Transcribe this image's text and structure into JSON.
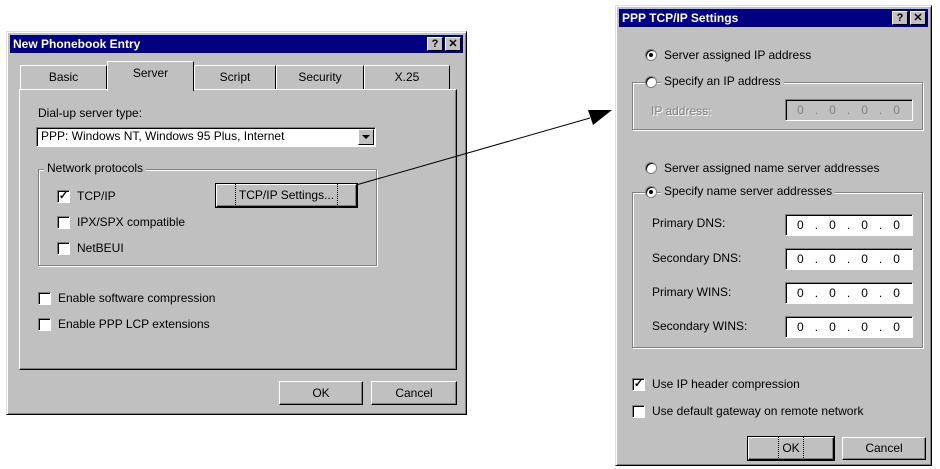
{
  "phonebook": {
    "title": "New Phonebook Entry",
    "tabs": [
      "Basic",
      "Server",
      "Script",
      "Security",
      "X.25"
    ],
    "dialup_server_type_label": "Dial-up server type:",
    "dialup_server_type_value": "PPP: Windows NT, Windows 95 Plus, Internet",
    "network_protocols_label": "Network protocols",
    "protocols": [
      {
        "label": "TCP/IP",
        "checked": true
      },
      {
        "label": "IPX/SPX compatible",
        "checked": false
      },
      {
        "label": "NetBEUI",
        "checked": false
      }
    ],
    "tcpip_settings_button": "TCP/IP Settings...",
    "enable_software_compression": "Enable software compression",
    "enable_ppp_lcp_extensions": "Enable PPP LCP extensions",
    "ok_button": "OK",
    "cancel_button": "Cancel",
    "help_glyph": "?",
    "close_glyph": "✕"
  },
  "ppp": {
    "title": "PPP TCP/IP Settings",
    "server_assigned_ip": "Server assigned IP address",
    "specify_ip": "Specify an IP address",
    "ip_address_label": "IP address:",
    "ip_address_value": [
      "0",
      "0",
      "0",
      "0"
    ],
    "server_assigned_name": "Server assigned name server addresses",
    "specify_name_server": "Specify name server addresses",
    "dns_rows": [
      {
        "label": "Primary DNS:",
        "value": [
          "0",
          "0",
          "0",
          "0"
        ]
      },
      {
        "label": "Secondary DNS:",
        "value": [
          "0",
          "0",
          "0",
          "0"
        ]
      },
      {
        "label": "Primary WINS:",
        "value": [
          "0",
          "0",
          "0",
          "0"
        ]
      },
      {
        "label": "Secondary WINS:",
        "value": [
          "0",
          "0",
          "0",
          "0"
        ]
      }
    ],
    "use_ip_header_compression": "Use IP header compression",
    "use_default_gateway": "Use default gateway on remote network",
    "ok_button": "OK",
    "cancel_button": "Cancel",
    "help_glyph": "?",
    "close_glyph": "✕"
  },
  "colors": {
    "titlebar": "#000080",
    "face": "#c0c0c0",
    "shadow": "#808080"
  }
}
